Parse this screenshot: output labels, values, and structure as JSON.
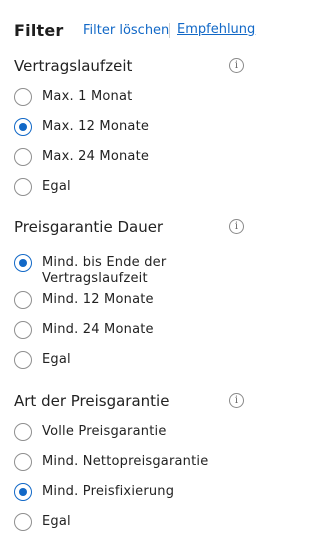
{
  "header": {
    "title": "Filter",
    "clear_label": "Filter löschen",
    "recommendation_label": "Empfehlung"
  },
  "colors": {
    "accent": "#1168c7",
    "radio_border": "#8f8f8f"
  },
  "sections": [
    {
      "title": "Vertragslaufzeit",
      "info_icon": "info-icon",
      "options": [
        {
          "label": "Max. 1 Monat",
          "checked": false
        },
        {
          "label": "Max. 12 Monate",
          "checked": true
        },
        {
          "label": "Max. 24 Monate",
          "checked": false
        },
        {
          "label": "Egal",
          "checked": false
        }
      ]
    },
    {
      "title": "Preisgarantie Dauer",
      "info_icon": "info-icon",
      "options": [
        {
          "label": "Mind. bis Ende der Vertragslaufzeit",
          "checked": true
        },
        {
          "label": "Mind. 12 Monate",
          "checked": false
        },
        {
          "label": "Mind. 24 Monate",
          "checked": false
        },
        {
          "label": "Egal",
          "checked": false
        }
      ]
    },
    {
      "title": "Art der Preisgarantie",
      "info_icon": "info-icon",
      "options": [
        {
          "label": "Volle Preisgarantie",
          "checked": false
        },
        {
          "label": "Mind. Nettopreisgarantie",
          "checked": false
        },
        {
          "label": "Mind. Preisfixierung",
          "checked": true
        },
        {
          "label": "Egal",
          "checked": false
        }
      ]
    }
  ]
}
